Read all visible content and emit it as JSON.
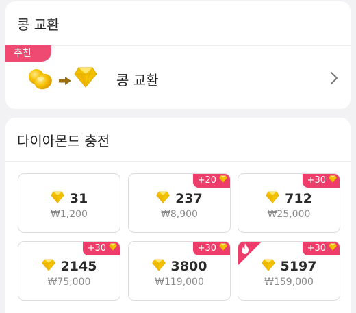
{
  "exchange": {
    "title": "콩 교환",
    "badge": "추천",
    "item_label": "콩 교환"
  },
  "charge": {
    "title": "다이아몬드 충전",
    "packages": [
      {
        "amount": "31",
        "price": "₩1,200",
        "bonus": ""
      },
      {
        "amount": "237",
        "price": "₩8,900",
        "bonus": "+20"
      },
      {
        "amount": "712",
        "price": "₩25,000",
        "bonus": "+30"
      },
      {
        "amount": "2145",
        "price": "₩75,000",
        "bonus": "+30"
      },
      {
        "amount": "3800",
        "price": "₩119,000",
        "bonus": "+30"
      },
      {
        "amount": "5197",
        "price": "₩159,000",
        "bonus": "+30",
        "hot": true
      }
    ]
  },
  "colors": {
    "accent": "#ee3d6a",
    "diamond": "#f5c400",
    "bean": "#f0b400"
  },
  "icons": [
    "bean-icon",
    "arrow-right-icon",
    "diamond-icon",
    "chevron-right-icon",
    "fire-icon"
  ]
}
